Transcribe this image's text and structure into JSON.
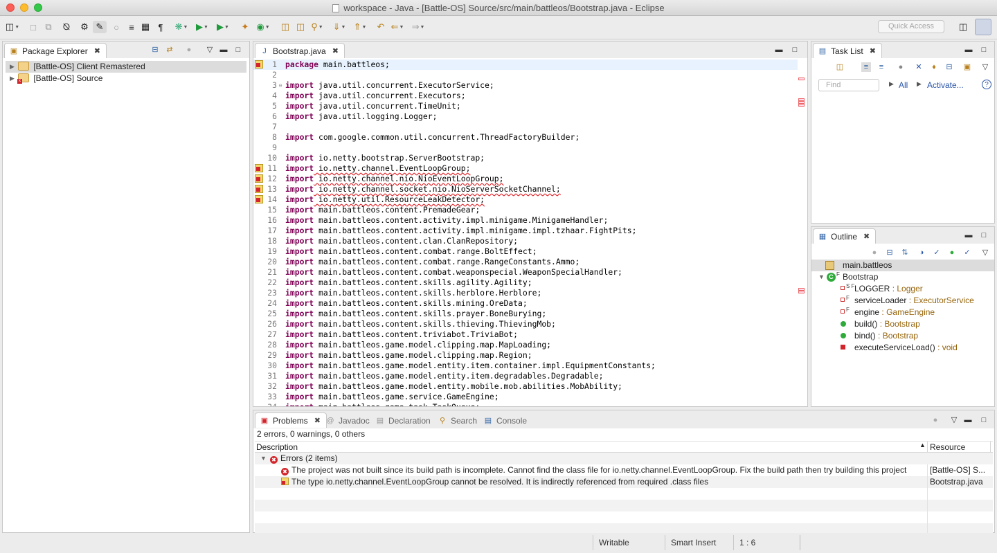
{
  "window": {
    "title": "workspace - Java - [Battle-OS] Source/src/main/battleos/Bootstrap.java - Eclipse"
  },
  "toolbar": {
    "quick_access_placeholder": "Quick Access"
  },
  "package_explorer": {
    "title": "Package Explorer",
    "items": [
      {
        "label": "[Battle-OS] Client Remastered",
        "selected": true
      },
      {
        "label": "[Battle-OS] Source",
        "selected": false
      }
    ]
  },
  "editor": {
    "tab_label": "Bootstrap.java",
    "lines": [
      {
        "n": "1",
        "kw": "package",
        "rest": " main.battleos;",
        "error": false,
        "marker": true,
        "current": true
      },
      {
        "n": "2",
        "kw": "",
        "rest": "",
        "error": false
      },
      {
        "n": "3",
        "kw": "import",
        "rest": " java.util.concurrent.ExecutorService;",
        "error": false,
        "fold": true
      },
      {
        "n": "4",
        "kw": "import",
        "rest": " java.util.concurrent.Executors;",
        "error": false
      },
      {
        "n": "5",
        "kw": "import",
        "rest": " java.util.concurrent.TimeUnit;",
        "error": false
      },
      {
        "n": "6",
        "kw": "import",
        "rest": " java.util.logging.Logger;",
        "error": false
      },
      {
        "n": "7",
        "kw": "",
        "rest": "",
        "error": false
      },
      {
        "n": "8",
        "kw": "import",
        "rest": " com.google.common.util.concurrent.ThreadFactoryBuilder;",
        "error": false
      },
      {
        "n": "9",
        "kw": "",
        "rest": "",
        "error": false
      },
      {
        "n": "10",
        "kw": "import",
        "rest": " io.netty.bootstrap.ServerBootstrap;",
        "error": false
      },
      {
        "n": "11",
        "kw": "import",
        "rest": " io.netty.channel.EventLoopGroup;",
        "error": true,
        "marker": true
      },
      {
        "n": "12",
        "kw": "import",
        "rest": " io.netty.channel.nio.NioEventLoopGroup;",
        "error": true,
        "marker": true
      },
      {
        "n": "13",
        "kw": "import",
        "rest": " io.netty.channel.socket.nio.NioServerSocketChannel;",
        "error": true,
        "marker": true
      },
      {
        "n": "14",
        "kw": "import",
        "rest": " io.netty.util.ResourceLeakDetector;",
        "error": true,
        "marker": true
      },
      {
        "n": "15",
        "kw": "import",
        "rest": " main.battleos.content.PremadeGear;",
        "error": false
      },
      {
        "n": "16",
        "kw": "import",
        "rest": " main.battleos.content.activity.impl.minigame.MinigameHandler;",
        "error": false
      },
      {
        "n": "17",
        "kw": "import",
        "rest": " main.battleos.content.activity.impl.minigame.impl.tzhaar.FightPits;",
        "error": false
      },
      {
        "n": "18",
        "kw": "import",
        "rest": " main.battleos.content.clan.ClanRepository;",
        "error": false
      },
      {
        "n": "19",
        "kw": "import",
        "rest": " main.battleos.content.combat.range.BoltEffect;",
        "error": false
      },
      {
        "n": "20",
        "kw": "import",
        "rest": " main.battleos.content.combat.range.RangeConstants.Ammo;",
        "error": false
      },
      {
        "n": "21",
        "kw": "import",
        "rest": " main.battleos.content.combat.weaponspecial.WeaponSpecialHandler;",
        "error": false
      },
      {
        "n": "22",
        "kw": "import",
        "rest": " main.battleos.content.skills.agility.Agility;",
        "error": false
      },
      {
        "n": "23",
        "kw": "import",
        "rest": " main.battleos.content.skills.herblore.Herblore;",
        "error": false
      },
      {
        "n": "24",
        "kw": "import",
        "rest": " main.battleos.content.skills.mining.OreData;",
        "error": false
      },
      {
        "n": "25",
        "kw": "import",
        "rest": " main.battleos.content.skills.prayer.BoneBurying;",
        "error": false
      },
      {
        "n": "26",
        "kw": "import",
        "rest": " main.battleos.content.skills.thieving.ThievingMob;",
        "error": false
      },
      {
        "n": "27",
        "kw": "import",
        "rest": " main.battleos.content.triviabot.TriviaBot;",
        "error": false
      },
      {
        "n": "28",
        "kw": "import",
        "rest": " main.battleos.game.model.clipping.map.MapLoading;",
        "error": false
      },
      {
        "n": "29",
        "kw": "import",
        "rest": " main.battleos.game.model.clipping.map.Region;",
        "error": false
      },
      {
        "n": "30",
        "kw": "import",
        "rest": " main.battleos.game.model.entity.item.container.impl.EquipmentConstants;",
        "error": false
      },
      {
        "n": "31",
        "kw": "import",
        "rest": " main.battleos.game.model.entity.item.degradables.Degradable;",
        "error": false
      },
      {
        "n": "32",
        "kw": "import",
        "rest": " main.battleos.game.model.entity.mobile.mob.abilities.MobAbility;",
        "error": false
      },
      {
        "n": "33",
        "kw": "import",
        "rest": " main.battleos.game.service.GameEngine;",
        "error": false
      },
      {
        "n": "34",
        "kw": "import",
        "rest": " main.battleos.game.task.TaskQueue;",
        "error": false
      }
    ]
  },
  "task_list": {
    "title": "Task List",
    "find_placeholder": "Find",
    "all_label": "All",
    "activate_label": "Activate..."
  },
  "outline": {
    "title": "Outline",
    "package": "main.battleos",
    "class_name": "Bootstrap",
    "members": [
      {
        "name": "LOGGER",
        "type": "Logger",
        "kind": "static-final-field",
        "mods": "S F"
      },
      {
        "name": "serviceLoader",
        "type": "ExecutorService",
        "kind": "private-final-field",
        "mods": "F"
      },
      {
        "name": "engine",
        "type": "GameEngine",
        "kind": "private-final-field",
        "mods": "F"
      },
      {
        "name": "build()",
        "type": "Bootstrap",
        "kind": "public-method",
        "mods": ""
      },
      {
        "name": "bind()",
        "type": "Bootstrap",
        "kind": "public-method",
        "mods": ""
      },
      {
        "name": "executeServiceLoad()",
        "type": "void",
        "kind": "private-method",
        "mods": ""
      }
    ]
  },
  "bottom_tabs": {
    "problems": "Problems",
    "javadoc": "Javadoc",
    "declaration": "Declaration",
    "search": "Search",
    "console": "Console"
  },
  "problems": {
    "summary": "2 errors, 0 warnings, 0 others",
    "col_description": "Description",
    "col_resource": "Resource",
    "group_label": "Errors (2 items)",
    "rows": [
      {
        "description": "The project was not built since its build path is incomplete. Cannot find the class file for io.netty.channel.EventLoopGroup. Fix the build path then try building this project",
        "resource": "[Battle-OS] S...",
        "extra": "",
        "icon": "error-circle"
      },
      {
        "description": "The type io.netty.channel.EventLoopGroup cannot be resolved. It is indirectly referenced from required .class files",
        "resource": "Bootstrap.java",
        "extra": "/",
        "icon": "error-class"
      }
    ]
  },
  "status": {
    "writable": "Writable",
    "insert_mode": "Smart Insert",
    "position": "1 : 6"
  },
  "colors": {
    "keyword": "#7f0055",
    "error": "#d2242a",
    "outline_type": "#96650c",
    "link": "#2a55a8"
  }
}
